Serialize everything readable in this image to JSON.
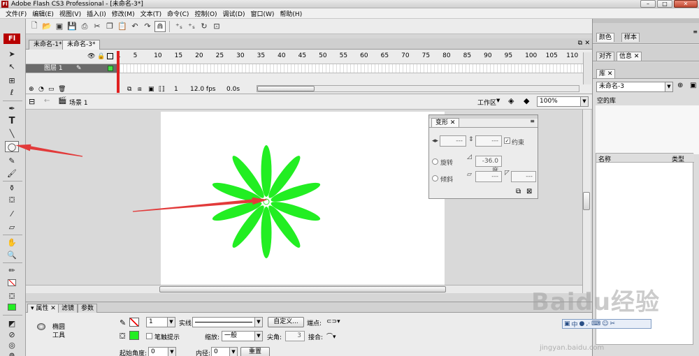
{
  "window": {
    "title": "Adobe Flash CS3 Professional - [未命名-3*]",
    "app_icon": "Fl"
  },
  "menu": {
    "items": [
      "文件(F)",
      "编辑(E)",
      "视图(V)",
      "插入(I)",
      "修改(M)",
      "文本(T)",
      "命令(C)",
      "控制(O)",
      "调试(D)",
      "窗口(W)",
      "帮助(H)"
    ]
  },
  "tools": {
    "logo": "Fl",
    "items": [
      "selection-tool",
      "subselection-tool",
      "free-transform-tool",
      "lasso-tool",
      "pen-tool",
      "text-tool",
      "line-tool",
      "oval-tool",
      "pencil-tool",
      "brush-tool",
      "ink-bottle-tool",
      "paint-bucket-tool",
      "eyedropper-tool",
      "eraser-tool",
      "hand-tool",
      "zoom-tool",
      "stroke-color",
      "fill-color"
    ],
    "selected": "oval-tool"
  },
  "doc_tabs": [
    {
      "label": "未命名-1*",
      "active": false
    },
    {
      "label": "未命名-3*",
      "active": true
    }
  ],
  "timeline": {
    "ruler": [
      "1",
      "5",
      "10",
      "15",
      "20",
      "25",
      "30",
      "35",
      "40",
      "45",
      "50",
      "55",
      "60",
      "65",
      "70",
      "75",
      "80",
      "85",
      "90",
      "95",
      "100",
      "105",
      "110"
    ],
    "layer_name": "图层 1",
    "frame": "1",
    "fps": "12.0 fps",
    "time": "0.0s"
  },
  "edit_bar": {
    "scene": "场景 1",
    "workspace": "工作区",
    "zoom": "100%"
  },
  "stage": {
    "flower_color": "#22ee22",
    "petal_count": 10,
    "rotation_step": 36
  },
  "transform_panel": {
    "tab": "变形",
    "width_value": "---",
    "height_value": "---",
    "constrain_label": "约束",
    "rotate_label": "旋转",
    "rotate_value": "-36.0度",
    "skew_label": "倾斜",
    "skew_h_value": "---",
    "skew_v_value": "---"
  },
  "properties": {
    "tabs": [
      {
        "label": "属性",
        "active": true
      },
      {
        "label": "滤镜",
        "active": false
      },
      {
        "label": "参数",
        "active": false
      }
    ],
    "tool_name_1": "椭圆",
    "tool_name_2": "工具",
    "stroke_height": "1",
    "stroke_style": "实线",
    "custom_button": "自定义...",
    "cap_label": "端点:",
    "hinting_label": "笔触提示",
    "scale_label": "缩放:",
    "scale_value": "一般",
    "miter_label": "尖角:",
    "miter_value": "3",
    "join_label": "接合:",
    "start_angle_label": "起始角度:",
    "start_angle_value": "0",
    "inner_radius_label": "内径:",
    "inner_radius_value": "0",
    "reset_button": "重置",
    "fill_color": "#22ee22"
  },
  "right_panel": {
    "tabs_row1": [
      {
        "label": "颜色",
        "active": true
      },
      {
        "label": "样本",
        "active": false
      }
    ],
    "tabs_row2": [
      {
        "label": "对齐",
        "active": false
      },
      {
        "label": "信息",
        "active": true
      }
    ],
    "library_tab": "库",
    "library_doc": "未命名-3",
    "empty_label": "空的库",
    "col_name": "名称",
    "col_type": "类型"
  },
  "watermark": {
    "brand": "Baidu经验",
    "url": "jingyan.baidu.com"
  },
  "ime": {
    "text": "中"
  },
  "colors": {
    "annotation_arrow": "#e23a3a",
    "chrome": "#ececec"
  }
}
